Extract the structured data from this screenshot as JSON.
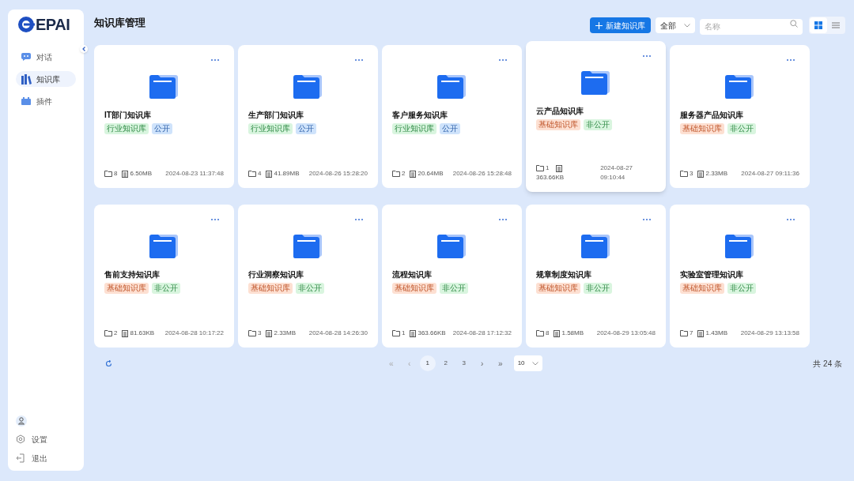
{
  "sidebar": {
    "logo": "EPAI",
    "items": [
      {
        "label": "对话",
        "selected": false
      },
      {
        "label": "知识库",
        "selected": true
      },
      {
        "label": "插件",
        "selected": false
      }
    ],
    "bottom": [
      {
        "label": "设置"
      },
      {
        "label": "退出"
      }
    ]
  },
  "header": {
    "title": "知识库管理",
    "new_button": "新建知识库",
    "filter": "全部",
    "search": {
      "placeholder": "名称"
    },
    "views": [
      {
        "kind": "grid",
        "selected": true
      },
      {
        "kind": "list",
        "selected": false
      }
    ]
  },
  "cards": [
    {
      "name": "IT部门知识库",
      "hovered": false,
      "tags": [
        {
          "label": "行业知识库",
          "kind": "green"
        },
        {
          "label": "公开",
          "kind": "blue"
        }
      ],
      "folders": "8",
      "size": "6.50MB",
      "time": "2024-08-23 11:37:48"
    },
    {
      "name": "生产部门知识库",
      "hovered": false,
      "tags": [
        {
          "label": "行业知识库",
          "kind": "green"
        },
        {
          "label": "公开",
          "kind": "blue"
        }
      ],
      "folders": "4",
      "size": "41.89MB",
      "time": "2024-08-26 15:28:20"
    },
    {
      "name": "客户服务知识库",
      "hovered": false,
      "tags": [
        {
          "label": "行业知识库",
          "kind": "green"
        },
        {
          "label": "公开",
          "kind": "blue"
        }
      ],
      "folders": "2",
      "size": "20.64MB",
      "time": "2024-08-26 15:28:48"
    },
    {
      "name": "云产品知识库",
      "hovered": true,
      "tags": [
        {
          "label": "基础知识库",
          "kind": "orange"
        },
        {
          "label": "非公开",
          "kind": "green"
        }
      ],
      "folders": "1",
      "size": "363.66KB",
      "time": "2024-08-27 09:10:44"
    },
    {
      "name": "服务器产品知识库",
      "hovered": false,
      "tags": [
        {
          "label": "基础知识库",
          "kind": "orange"
        },
        {
          "label": "非公开",
          "kind": "green"
        }
      ],
      "folders": "3",
      "size": "2.33MB",
      "time": "2024-08-27 09:11:36"
    },
    {
      "name": "售前支持知识库",
      "hovered": false,
      "tags": [
        {
          "label": "基础知识库",
          "kind": "orange"
        },
        {
          "label": "非公开",
          "kind": "green"
        }
      ],
      "folders": "2",
      "size": "81.63KB",
      "time": "2024-08-28 10:17:22"
    },
    {
      "name": "行业洞察知识库",
      "hovered": false,
      "tags": [
        {
          "label": "基础知识库",
          "kind": "orange"
        },
        {
          "label": "非公开",
          "kind": "green"
        }
      ],
      "folders": "3",
      "size": "2.33MB",
      "time": "2024-08-28 14:26:30"
    },
    {
      "name": "流程知识库",
      "hovered": false,
      "tags": [
        {
          "label": "基础知识库",
          "kind": "orange"
        },
        {
          "label": "非公开",
          "kind": "green"
        }
      ],
      "folders": "1",
      "size": "363.66KB",
      "time": "2024-08-28 17:12:32"
    },
    {
      "name": "规章制度知识库",
      "hovered": false,
      "tags": [
        {
          "label": "基础知识库",
          "kind": "orange"
        },
        {
          "label": "非公开",
          "kind": "green"
        }
      ],
      "folders": "8",
      "size": "1.58MB",
      "time": "2024-08-29 13:05:48"
    },
    {
      "name": "实验室管理知识库",
      "hovered": false,
      "tags": [
        {
          "label": "基础知识库",
          "kind": "orange"
        },
        {
          "label": "非公开",
          "kind": "green"
        }
      ],
      "folders": "7",
      "size": "1.43MB",
      "time": "2024-08-29 13:13:58"
    }
  ],
  "pagination": {
    "first": "«",
    "prev": "‹",
    "pages": [
      {
        "label": "1",
        "selected": true
      },
      {
        "label": "2",
        "selected": false
      },
      {
        "label": "3",
        "selected": false
      }
    ],
    "next": "›",
    "last": "»",
    "page_size": "10",
    "total": "共 24 条"
  }
}
